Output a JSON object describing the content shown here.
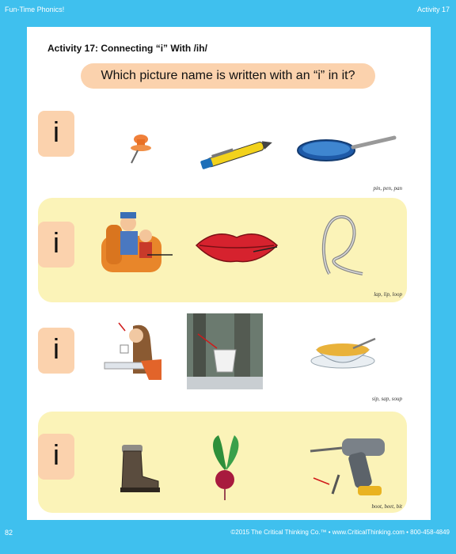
{
  "header": {
    "series": "Fun-Time Phonics!",
    "activity": "Activity 17"
  },
  "title": "Activity 17:  Connecting “i” With /ih/",
  "question": "Which picture name is written with an “i” in it?",
  "rows": [
    {
      "letter": "i",
      "caption": "pin, pen, pan",
      "pictures": [
        "pushpin-icon",
        "pen-icon",
        "frying-pan-icon"
      ]
    },
    {
      "letter": "i",
      "caption": "lap, lip, loop",
      "pictures": [
        "lap-icon",
        "lips-icon",
        "loop-icon"
      ]
    },
    {
      "letter": "i",
      "caption": "sip, sap, soup",
      "pictures": [
        "sip-icon",
        "sap-bucket-icon",
        "soup-bowl-icon"
      ]
    },
    {
      "letter": "i",
      "caption": "boot, beet, bit",
      "pictures": [
        "boot-icon",
        "beet-icon",
        "drill-bit-icon"
      ]
    }
  ],
  "footer": {
    "page_number": "82",
    "copyright": "©2015 The Critical Thinking Co.™ • www.CriticalThinking.com • 800-458-4849"
  },
  "colors": {
    "border": "#3fc0ee",
    "peach": "#fbd2ad",
    "band": "#fbf3b8"
  }
}
